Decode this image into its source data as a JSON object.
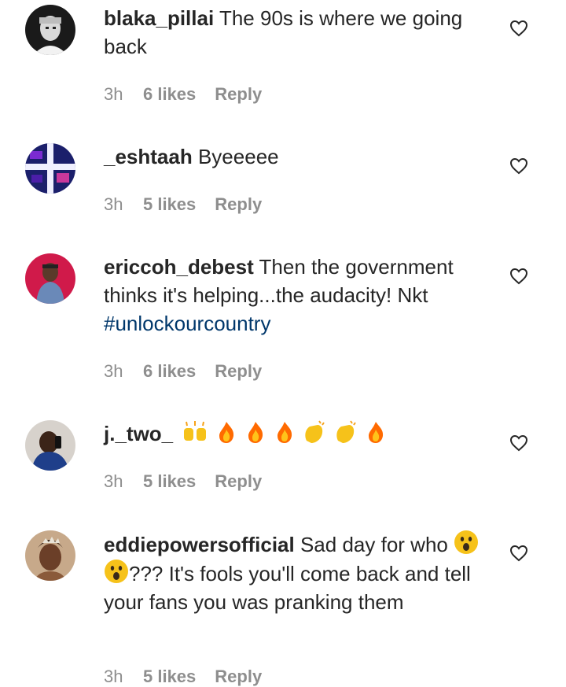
{
  "comments": [
    {
      "username": "blaka_pillai",
      "text": "The 90s is where we going back",
      "time": "3h",
      "likes": "6 likes",
      "reply": "Reply",
      "avatar_icon": "avatar-bandana-man"
    },
    {
      "username": "_eshtaah",
      "text": "Byeeeee",
      "time": "3h",
      "likes": "5 likes",
      "reply": "Reply",
      "avatar_icon": "avatar-neon-cross"
    },
    {
      "username": "ericcoh_debest",
      "text": "Then the government thinks it's helping...the audacity! Nkt",
      "hashtag": "#unlockourcountry",
      "time": "3h",
      "likes": "6 likes",
      "reply": "Reply",
      "avatar_icon": "avatar-man-red-background"
    },
    {
      "username": "j._two_",
      "emojis": [
        "raising-hands-emoji",
        "fire-emoji",
        "fire-emoji",
        "fire-emoji",
        "clapping-hands-emoji",
        "clapping-hands-emoji",
        "fire-emoji"
      ],
      "time": "3h",
      "likes": "5 likes",
      "reply": "Reply",
      "avatar_icon": "avatar-man-selfie"
    },
    {
      "username": "eddiepowersofficial",
      "text_before": "Sad day for who",
      "emojis": [
        "astonished-face-emoji",
        "astonished-face-emoji"
      ],
      "text_after": "??? It's fools you'll come back and tell your fans you was pranking them",
      "time": "3h",
      "likes": "5 likes",
      "reply": "Reply",
      "avatar_icon": "avatar-woman-tiara"
    }
  ],
  "colors": {
    "text": "#262626",
    "meta": "#8e8e8e",
    "hashtag": "#00376b"
  }
}
